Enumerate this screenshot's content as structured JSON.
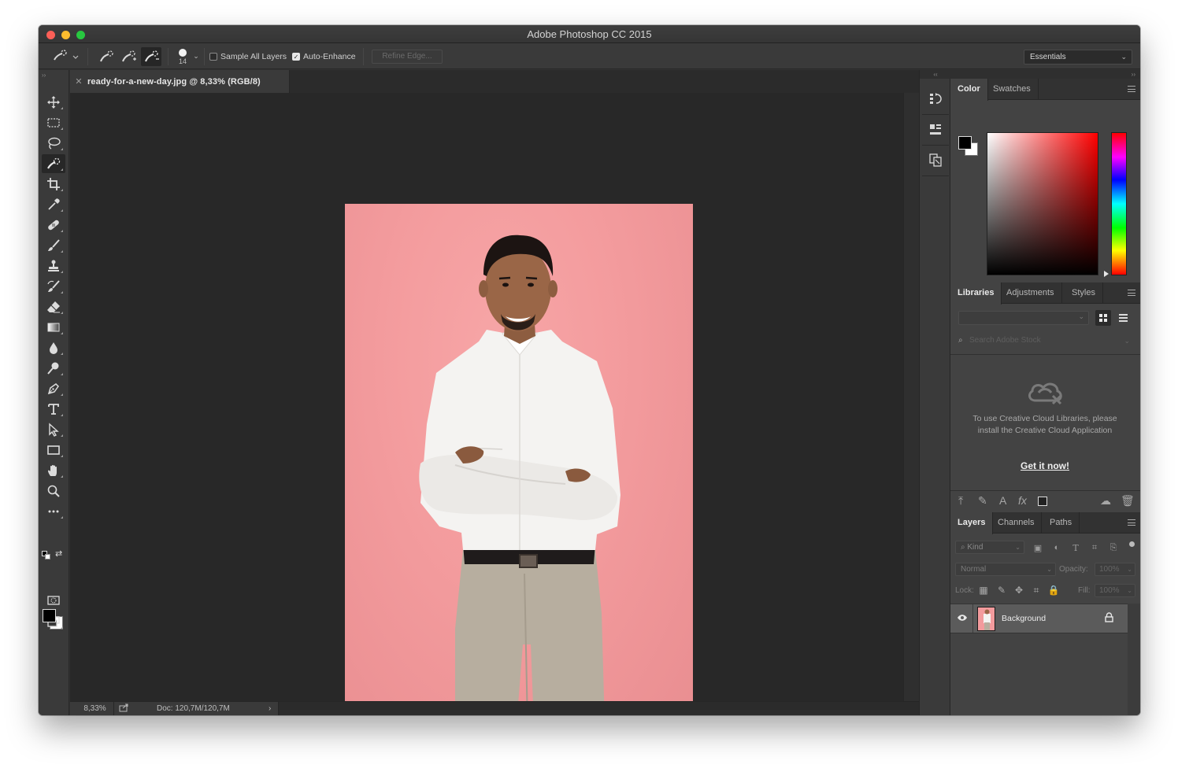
{
  "window": {
    "title": "Adobe Photoshop CC 2015"
  },
  "options_bar": {
    "brush_size": "14",
    "sample_all_layers": {
      "label": "Sample All Layers",
      "checked": false
    },
    "auto_enhance": {
      "label": "Auto-Enhance",
      "checked": true
    },
    "refine_edge_label": "Refine Edge...",
    "workspace": "Essentials"
  },
  "toolbar": {
    "tools": [
      "move-tool",
      "rectangular-marquee-tool",
      "lasso-tool",
      "quick-selection-tool",
      "crop-tool",
      "eyedropper-tool",
      "healing-brush-tool",
      "brush-tool",
      "clone-stamp-tool",
      "history-brush-tool",
      "eraser-tool",
      "gradient-tool",
      "blur-tool",
      "dodge-tool",
      "pen-tool",
      "type-tool",
      "path-selection-tool",
      "rectangle-tool",
      "hand-tool",
      "zoom-tool",
      "edit-toolbar"
    ],
    "active_tool": "quick-selection-tool",
    "foreground_color": "#000000",
    "background_color": "#ffffff"
  },
  "document": {
    "tab_title": "ready-for-a-new-day.jpg @ 8,33% (RGB/8)",
    "zoom": "8,33%",
    "doc_info": "Doc: 120,7M/120,7M",
    "backdrop_color": "#f39b9d"
  },
  "panels": {
    "color": {
      "tabs": [
        "Color",
        "Swatches"
      ],
      "active_tab": "Color",
      "hue": "#ff0000"
    },
    "libraries": {
      "tabs": [
        "Libraries",
        "Adjustments",
        "Styles"
      ],
      "active_tab": "Libraries",
      "search_placeholder": "Search Adobe Stock",
      "message": "To use Creative Cloud Libraries, please install the Creative Cloud Application",
      "link": "Get it now!"
    },
    "layers": {
      "tabs": [
        "Layers",
        "Channels",
        "Paths"
      ],
      "active_tab": "Layers",
      "filter_kind": "Kind",
      "blend_mode": "Normal",
      "opacity_label": "Opacity:",
      "opacity_value": "100%",
      "lock_label": "Lock:",
      "fill_label": "Fill:",
      "fill_value": "100%",
      "layers": [
        {
          "name": "Background",
          "visible": true,
          "locked": true
        }
      ]
    }
  }
}
